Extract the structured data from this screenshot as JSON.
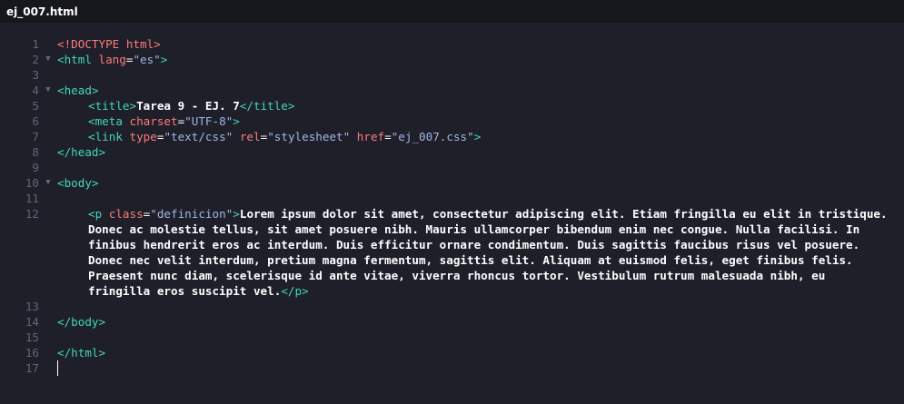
{
  "window": {
    "tab_title": "ej_007.html"
  },
  "editor": {
    "line_numbers": [
      "1",
      "2",
      "3",
      "4",
      "5",
      "6",
      "7",
      "8",
      "9",
      "10",
      "11",
      "12",
      "13",
      "14",
      "15",
      "16",
      "17"
    ],
    "fold_marker": "▼",
    "tokens": {
      "doctype": "<!DOCTYPE html>",
      "html_open": "<html ",
      "lang_attr": "lang",
      "lang_eq": "=",
      "lang_val": "\"es\"",
      "html_close_bracket": ">",
      "head_open": "<head>",
      "title_open": "<title>",
      "title_text": "Tarea 9 - EJ. 7",
      "title_close": "</title>",
      "meta_open": "<meta ",
      "charset_attr": "charset",
      "charset_eq": "=",
      "charset_val": "\"UTF-8\"",
      "meta_close": ">",
      "link_open": "<link ",
      "type_attr": "type",
      "type_eq": "=",
      "type_val": "\"text/css\"",
      "rel_attr": " rel",
      "rel_eq": "=",
      "rel_val": "\"stylesheet\"",
      "href_attr": " href",
      "href_eq": "=",
      "href_val": "\"ej_007.css\"",
      "link_close": ">",
      "head_close": "</head>",
      "body_open": "<body>",
      "p_open": "<p ",
      "class_attr": "class",
      "class_eq": "=",
      "class_val": "\"definicion\"",
      "p_open_close": ">",
      "p_text": "Lorem ipsum dolor sit amet, consectetur adipiscing elit. Etiam fringilla eu elit in tristique. Donec ac molestie tellus, sit amet posuere nibh. Mauris ullamcorper bibendum enim nec congue. Nulla facilisi. In finibus hendrerit eros ac interdum. Duis efficitur ornare condimentum. Duis sagittis faucibus risus vel posuere. Donec nec velit interdum, pretium magna fermentum, sagittis elit. Aliquam at euismod felis, eget finibus felis. Praesent nunc diam, scelerisque id ante vitae, viverra rhoncus tortor. Vestibulum rutrum malesuada nibh, eu fringilla eros suscipit vel.",
      "p_close": "</p>",
      "body_close": "</body>",
      "html_close": "</html>"
    }
  }
}
